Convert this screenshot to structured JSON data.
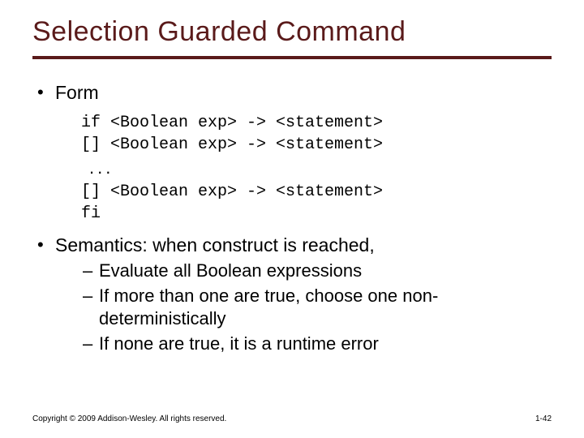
{
  "title": "Selection Guarded Command",
  "bullets": {
    "form_label": "Form",
    "semantics_label": "Semantics: when construct is reached,"
  },
  "code": {
    "line1": "if <Boolean exp> -> <statement>",
    "line2": "[] <Boolean exp> -> <statement>",
    "ellipsis": "...",
    "line3": "[] <Boolean exp> -> <statement>",
    "line4": "fi"
  },
  "sub": {
    "s1": "Evaluate all Boolean expressions",
    "s2": "If more than one are true, choose one non-deterministically",
    "s3": "If none are true, it is a runtime error"
  },
  "footer": {
    "copyright": "Copyright © 2009 Addison-Wesley. All rights reserved.",
    "page": "1-42"
  }
}
